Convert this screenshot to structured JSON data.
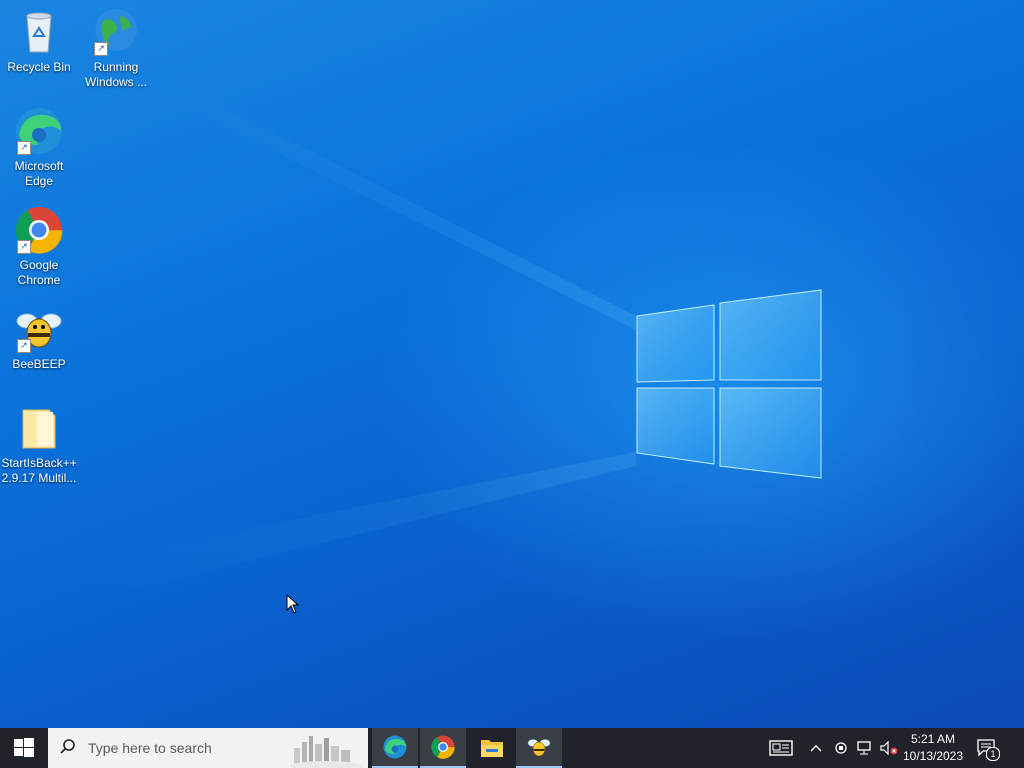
{
  "desktop": {
    "icons": [
      {
        "label": "Recycle Bin",
        "icon": "recycle-bin-icon"
      },
      {
        "label": "Running Windows ...",
        "icon": "globe-icon"
      },
      {
        "label": "Microsoft Edge",
        "icon": "edge-icon"
      },
      {
        "label": "Google Chrome",
        "icon": "chrome-icon"
      },
      {
        "label": "BeeBEEP",
        "icon": "bee-icon"
      },
      {
        "label": "StartIsBack++ 2.9.17 Multil...",
        "icon": "folder-icon"
      }
    ]
  },
  "taskbar": {
    "start_icon": "windows-logo-icon",
    "search": {
      "placeholder": "Type here to search",
      "icon": "search-icon"
    },
    "apps": [
      {
        "icon": "edge-icon"
      },
      {
        "icon": "chrome-icon"
      },
      {
        "icon": "file-explorer-icon"
      },
      {
        "icon": "bee-icon"
      }
    ],
    "tray": {
      "icons": [
        "news-widget-icon",
        "chevron-up-icon",
        "meet-now-icon",
        "network-icon",
        "volume-muted-icon"
      ],
      "time": "5:21 AM",
      "date": "10/13/2023",
      "notification_count": "1"
    }
  },
  "colors": {
    "taskbar": "#20242a",
    "desktop_blue": "#0a74dc",
    "accent": "#9ac4f8"
  }
}
